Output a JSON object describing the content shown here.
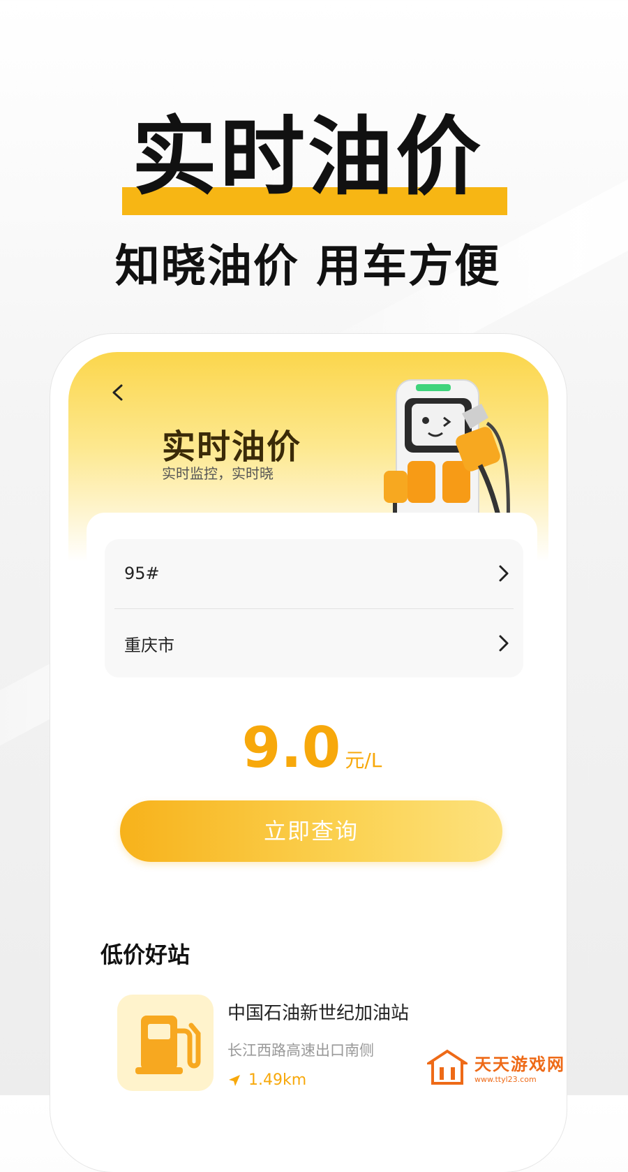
{
  "promo": {
    "headline": "实时油价",
    "subheadline": "知晓油价 用车方便"
  },
  "app": {
    "title": "实时油价",
    "subtitle": "实时监控，实时晓",
    "fuel_type": "95#",
    "city": "重庆市",
    "price_value": "9.0",
    "price_unit": "元/L",
    "query_button": "立即查询",
    "section_title": "低价好站",
    "station": {
      "name": "中国石油新世纪加油站",
      "address": "长江西路高速出口南侧",
      "distance": "1.49km"
    }
  },
  "watermark": {
    "name": "天天游戏网",
    "url": "www.ttyl23.com"
  },
  "colors": {
    "accent": "#f7b614",
    "price": "#f7a80b",
    "header_yellow": "#fbd64c",
    "watermark": "#ee6a17"
  },
  "icons": [
    "back-arrow-icon",
    "chevron-right-icon",
    "fuel-pump-icon",
    "navigation-arrow-icon",
    "logo-icon"
  ]
}
